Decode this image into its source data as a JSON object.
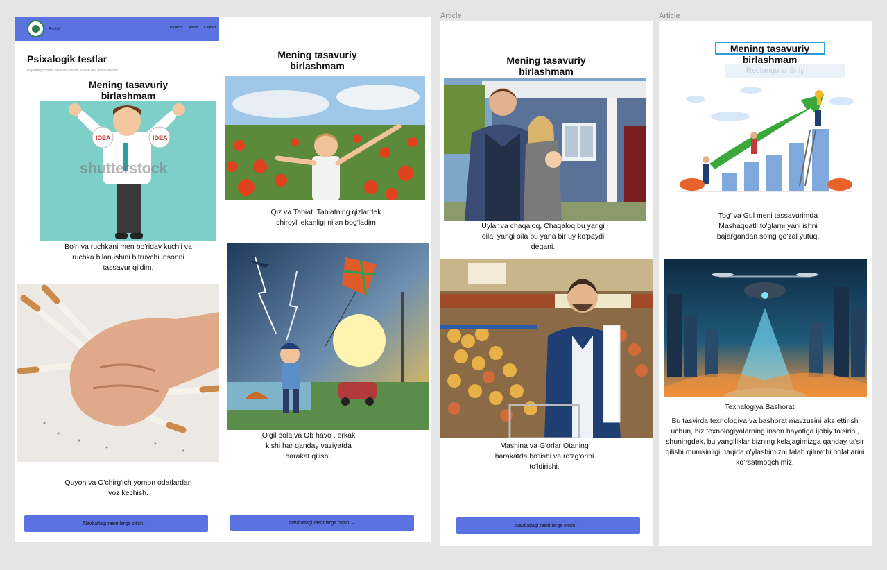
{
  "frames": {
    "article_label_1": "Article",
    "article_label_2": "Article"
  },
  "nav": {
    "brand": "Portfuli",
    "links": [
      "Projects",
      "About",
      "Contact"
    ]
  },
  "page1": {
    "title": "Psixalogik testlar",
    "subtitle": "Bajaradigan ishni tasvirlab berishi, bu ish test uchun muhim",
    "heading": "Mening tasavuriy birlashmam",
    "card1_caption": "Bo'ri va ruchkani men bo'riday kuchli va ruchka bilan ishini bitruvchi insonni tassavur qildim.",
    "card1_watermark": "shutterstock",
    "card1_badge": "IDEA",
    "card2_caption": "Quyon va O'chirg'ich yomon odatlardan voz kechish.",
    "button": "Navbattagi rasimlarga o'tish →"
  },
  "page2": {
    "heading": "Mening tasavuriy birlashmam",
    "card1_caption": "Qiz va Tabiat. Tabiatning qizlardek chiroyli ekanligi nilan bog'ladim",
    "card2_caption": "O'gil bola va Ob havo , erkak kishi har qanday vaziyatda harakat qilishi.",
    "button": "Navbattagi rasimlarga o'tish →"
  },
  "page3": {
    "heading": "Mening tasavuriy birlashmam",
    "card1_caption": "Uylar va chaqaloq, Chaqaloq bu yangi oila, yangi oila bu yana bir uy ko'paydi degani.",
    "card2_caption": "Mashina va G'orlar Otaning harakatda bo'lishi va ro'zg'orini to'ldirishi.",
    "button": "Navbattagi rasimlarga o'tish →"
  },
  "page4": {
    "heading": "Mening tasavuriy birlashmam",
    "ghost_tooltip": "Rectangular Snip",
    "card1_caption": "Tog' va Gul meni tassavurimda Mashaqqatli to'glarni yani ishni bajargandan so'ng go'zal yutuq.",
    "card2_title": "Texnalogiya Bashorat",
    "card2_caption": "Bu tasvirda texnologiya va bashorat mavzusini aks ettirish uchun, biz texnologiyalarning inson hayotiga ijobiy ta'sirini, shuningdek, bu yangiliklar bizning kelajagimizga qanday ta'sir qilishi mumkinligi haqida o'ylashimizni talab qiluvchi holatlarini ko'rsatmoqchimiz."
  },
  "colors": {
    "accent": "#5b73e0",
    "canvas": "#e5e5e5",
    "selection": "#2d9cdb"
  }
}
